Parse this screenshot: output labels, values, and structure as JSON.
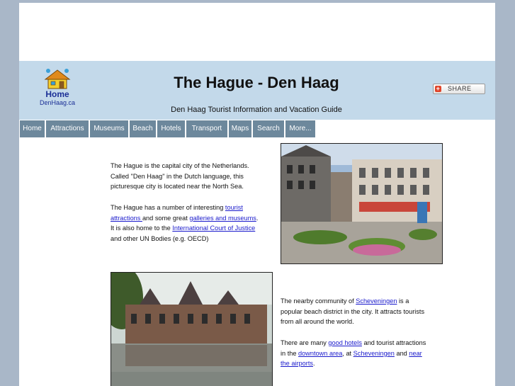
{
  "header": {
    "home_label": "Home",
    "home_site": "DenHaag.ca",
    "title": "The Hague - Den Haag",
    "subtitle": "Den Haag Tourist Information and Vacation Guide",
    "share_label": "SHARE"
  },
  "nav": {
    "items": [
      {
        "label": "Home"
      },
      {
        "label": "Attractions"
      },
      {
        "label": "Museums"
      },
      {
        "label": "Beach"
      },
      {
        "label": "Hotels"
      },
      {
        "label": "Transport"
      },
      {
        "label": "Maps"
      },
      {
        "label": "Search"
      },
      {
        "label": "More..."
      }
    ]
  },
  "content": {
    "intro": {
      "line1": "The Hague is the capital city of the Netherlands.",
      "line2": "Called \"Den Haag\" in the Dutch language, this",
      "line3": "picturesque city is located near the North Sea."
    },
    "attractions": {
      "t1": "The Hague has a number of interesting ",
      "link1": "tourist",
      "link1b": "attractions ",
      "t2": "and some great ",
      "link2": "galleries and museums",
      "t3": ".",
      "t4": "It is also home to the ",
      "link3": "International Court of Justice",
      "t5": "and other UN Bodies (e.g. OECD)"
    },
    "beach": {
      "t1": "The nearby community of ",
      "link1": "Scheveningen",
      "t2": " is a",
      "t3": "popular beach district in the city.  It attracts tourists",
      "t4": "from all around the world."
    },
    "hotels": {
      "t1": "There are many ",
      "link1": "good hotels",
      "t2": " and tourist attractions",
      "t3": "in the ",
      "link2": "downtown area",
      "t4": ", at ",
      "link3": "Scheveningen",
      "t5": " and ",
      "link4": "near",
      "link4b": "the airports",
      "t6": "."
    }
  },
  "colors": {
    "background": "#a9b7c8",
    "banner": "#c3d9ea",
    "nav": "#6d889c",
    "link": "#1a1acc"
  }
}
